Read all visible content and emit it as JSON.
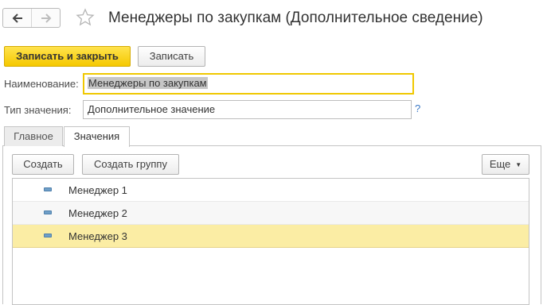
{
  "header": {
    "title": "Менеджеры по закупкам (Дополнительное сведение)",
    "back_icon": "arrow-left-icon",
    "forward_icon": "arrow-right-icon",
    "favorite_icon": "star-icon"
  },
  "toolbar": {
    "save_close_label": "Записать и закрыть",
    "save_label": "Записать"
  },
  "form": {
    "name_label": "Наименование:",
    "name_value": "Менеджеры по закупкам",
    "type_label": "Тип значения:",
    "type_value": "Дополнительное значение",
    "help_label": "?"
  },
  "tabs": [
    {
      "label": "Главное",
      "active": false
    },
    {
      "label": "Значения",
      "active": true
    }
  ],
  "values_toolbar": {
    "create_label": "Создать",
    "create_group_label": "Создать группу",
    "more_label": "Еще"
  },
  "list": {
    "items": [
      {
        "label": "Менеджер 1",
        "selected": false
      },
      {
        "label": "Менеджер 2",
        "selected": false
      },
      {
        "label": "Менеджер 3",
        "selected": true
      }
    ]
  },
  "colors": {
    "primary_button": "#f5c800",
    "selected_row": "#fbeda4",
    "focus_border": "#f0c800",
    "help_link": "#3a78c5"
  }
}
